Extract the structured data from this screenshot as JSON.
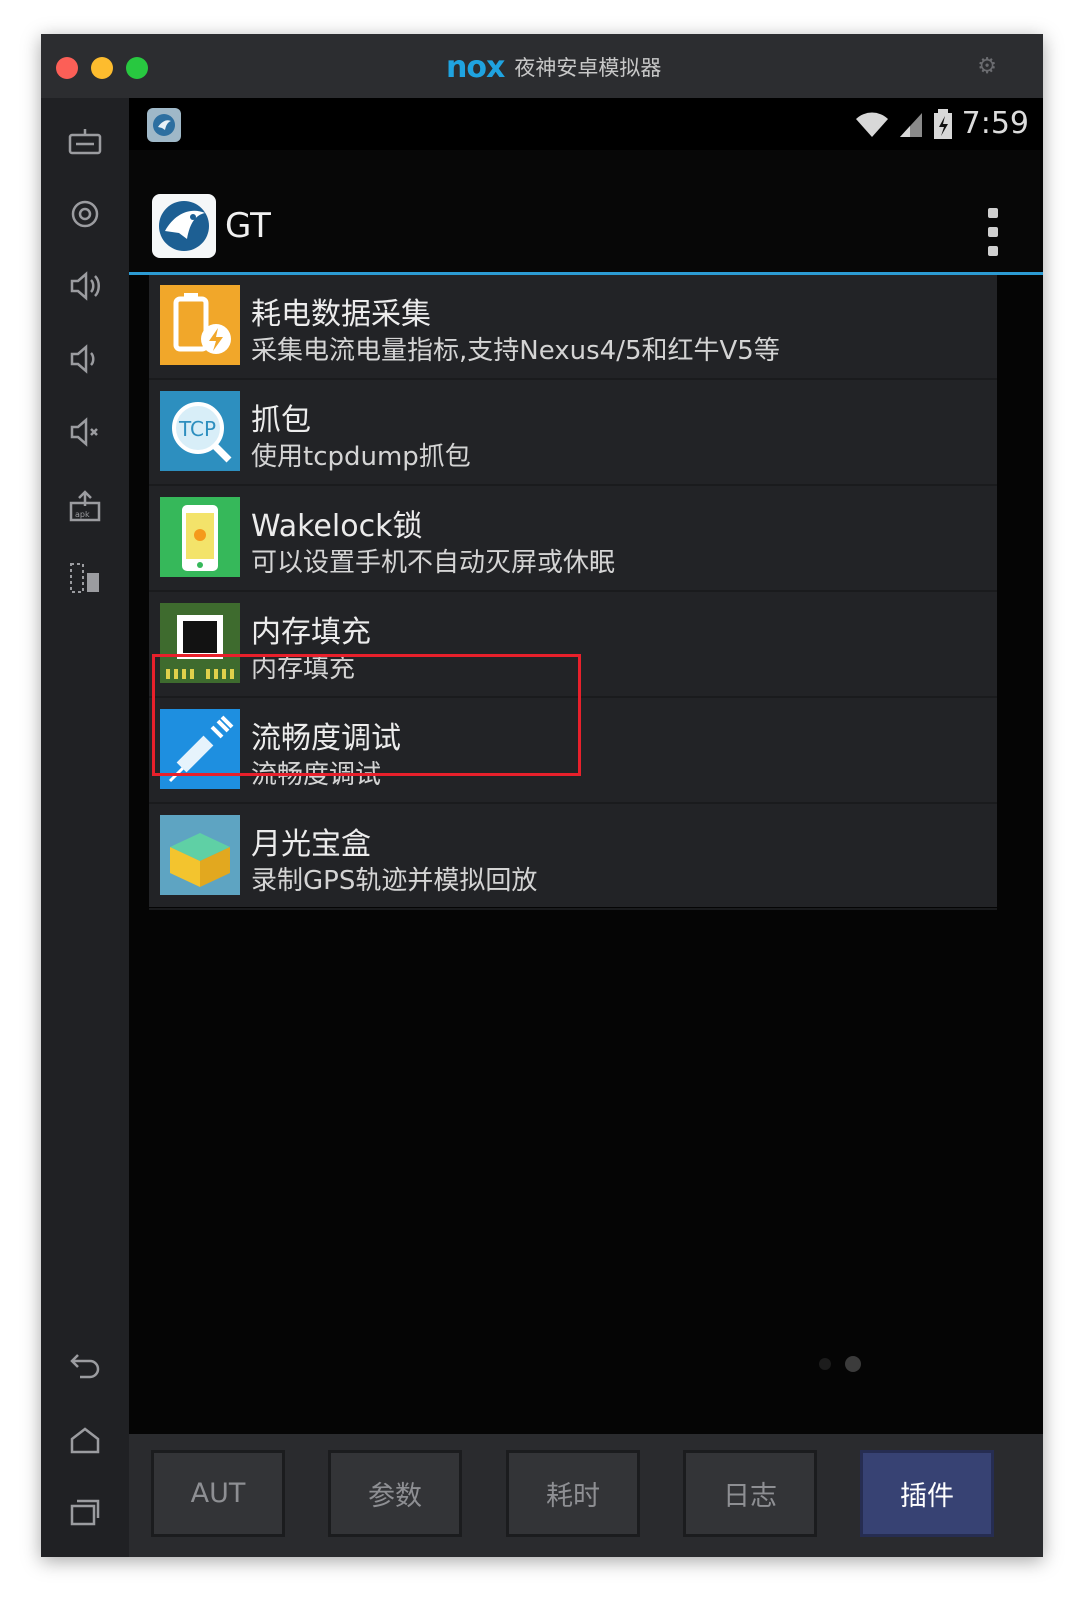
{
  "window": {
    "brand_logo": "nox",
    "title": "夜神安卓模拟器",
    "traffic_lights": [
      "close",
      "minimize",
      "zoom"
    ]
  },
  "sidebar": {
    "items": [
      {
        "icon": "keyboard-icon"
      },
      {
        "icon": "location-icon"
      },
      {
        "icon": "volume-up-icon"
      },
      {
        "icon": "volume-down-icon"
      },
      {
        "icon": "mute-icon"
      },
      {
        "icon": "apk-install-icon"
      },
      {
        "icon": "multi-window-icon"
      },
      {
        "icon": "back-icon"
      },
      {
        "icon": "home-icon"
      },
      {
        "icon": "recent-apps-icon"
      }
    ]
  },
  "statusbar": {
    "time": "7:59"
  },
  "actionbar": {
    "title": "GT"
  },
  "plugins": [
    {
      "name": "耗电数据采集",
      "desc": "采集电流电量指标,支持Nexus4/5和红牛V5等",
      "icon": "battery-icon"
    },
    {
      "name": "抓包",
      "desc": "使用tcpdump抓包",
      "icon": "tcp-icon"
    },
    {
      "name": "Wakelock锁",
      "desc": "可以设置手机不自动灭屏或休眠",
      "icon": "phone-light-icon"
    },
    {
      "name": "内存填充",
      "desc": "内存填充",
      "icon": "memory-chip-icon"
    },
    {
      "name": "流畅度调试",
      "desc": "流畅度调试",
      "icon": "syringe-icon"
    },
    {
      "name": "月光宝盒",
      "desc": "录制GPS轨迹并模拟回放",
      "icon": "treasure-box-icon"
    }
  ],
  "tabs": [
    {
      "label": "AUT",
      "active": false
    },
    {
      "label": "参数",
      "active": false
    },
    {
      "label": "耗时",
      "active": false
    },
    {
      "label": "日志",
      "active": false
    },
    {
      "label": "插件",
      "active": true
    }
  ],
  "colors": {
    "accent": "#2c9bd3",
    "highlight": "#e8202b",
    "active_tab": "#374273"
  }
}
